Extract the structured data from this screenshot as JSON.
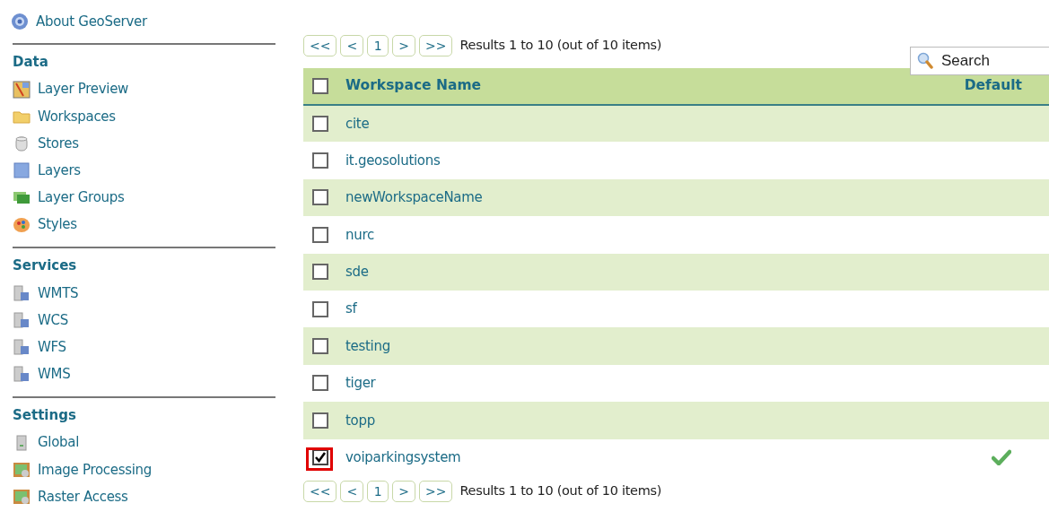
{
  "sidebar": {
    "about": {
      "label": "About GeoServer",
      "kind": "about"
    },
    "sections": [
      {
        "title": "Data",
        "items": [
          {
            "label": "Layer Preview",
            "kind": "preview"
          },
          {
            "label": "Workspaces",
            "kind": "folder"
          },
          {
            "label": "Stores",
            "kind": "store"
          },
          {
            "label": "Layers",
            "kind": "layer"
          },
          {
            "label": "Layer Groups",
            "kind": "group"
          },
          {
            "label": "Styles",
            "kind": "style"
          }
        ]
      },
      {
        "title": "Services",
        "items": [
          {
            "label": "WMTS",
            "kind": "service"
          },
          {
            "label": "WCS",
            "kind": "service"
          },
          {
            "label": "WFS",
            "kind": "service"
          },
          {
            "label": "WMS",
            "kind": "service"
          }
        ]
      },
      {
        "title": "Settings",
        "items": [
          {
            "label": "Global",
            "kind": "server"
          },
          {
            "label": "Image Processing",
            "kind": "raster"
          },
          {
            "label": "Raster Access",
            "kind": "raster"
          }
        ]
      }
    ]
  },
  "pager_top": {
    "buttons": [
      "<<",
      "<",
      "1",
      ">",
      ">>"
    ],
    "summary": "Results 1 to 10 (out of 10 items)"
  },
  "search": {
    "placeholder": "Search"
  },
  "table": {
    "columns": [
      "Workspace Name",
      "Default"
    ],
    "header_checked": false,
    "rows": [
      {
        "name": "cite",
        "checked": false,
        "default": false,
        "highlighted": false
      },
      {
        "name": "it.geosolutions",
        "checked": false,
        "default": false,
        "highlighted": false
      },
      {
        "name": "newWorkspaceName",
        "checked": false,
        "default": false,
        "highlighted": false
      },
      {
        "name": "nurc",
        "checked": false,
        "default": false,
        "highlighted": false
      },
      {
        "name": "sde",
        "checked": false,
        "default": false,
        "highlighted": false
      },
      {
        "name": "sf",
        "checked": false,
        "default": false,
        "highlighted": false
      },
      {
        "name": "testing",
        "checked": false,
        "default": false,
        "highlighted": false
      },
      {
        "name": "tiger",
        "checked": false,
        "default": false,
        "highlighted": false
      },
      {
        "name": "topp",
        "checked": false,
        "default": false,
        "highlighted": false
      },
      {
        "name": "voiparkingsystem",
        "checked": true,
        "default": true,
        "highlighted": true
      }
    ]
  },
  "pager_bottom": {
    "buttons": [
      "<<",
      "<",
      "1",
      ">",
      ">>"
    ],
    "summary": "Results 1 to 10 (out of 10 items)"
  }
}
